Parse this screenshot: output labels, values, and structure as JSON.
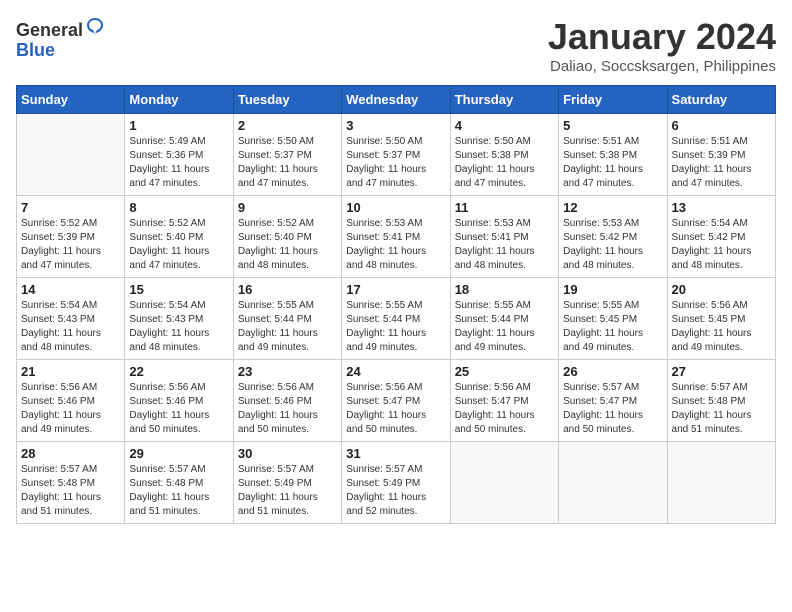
{
  "header": {
    "logo_line1": "General",
    "logo_line2": "Blue",
    "month_title": "January 2024",
    "subtitle": "Daliao, Soccsksargen, Philippines"
  },
  "days_of_week": [
    "Sunday",
    "Monday",
    "Tuesday",
    "Wednesday",
    "Thursday",
    "Friday",
    "Saturday"
  ],
  "weeks": [
    [
      {
        "num": "",
        "info": ""
      },
      {
        "num": "1",
        "info": "Sunrise: 5:49 AM\nSunset: 5:36 PM\nDaylight: 11 hours\nand 47 minutes."
      },
      {
        "num": "2",
        "info": "Sunrise: 5:50 AM\nSunset: 5:37 PM\nDaylight: 11 hours\nand 47 minutes."
      },
      {
        "num": "3",
        "info": "Sunrise: 5:50 AM\nSunset: 5:37 PM\nDaylight: 11 hours\nand 47 minutes."
      },
      {
        "num": "4",
        "info": "Sunrise: 5:50 AM\nSunset: 5:38 PM\nDaylight: 11 hours\nand 47 minutes."
      },
      {
        "num": "5",
        "info": "Sunrise: 5:51 AM\nSunset: 5:38 PM\nDaylight: 11 hours\nand 47 minutes."
      },
      {
        "num": "6",
        "info": "Sunrise: 5:51 AM\nSunset: 5:39 PM\nDaylight: 11 hours\nand 47 minutes."
      }
    ],
    [
      {
        "num": "7",
        "info": "Sunrise: 5:52 AM\nSunset: 5:39 PM\nDaylight: 11 hours\nand 47 minutes."
      },
      {
        "num": "8",
        "info": "Sunrise: 5:52 AM\nSunset: 5:40 PM\nDaylight: 11 hours\nand 47 minutes."
      },
      {
        "num": "9",
        "info": "Sunrise: 5:52 AM\nSunset: 5:40 PM\nDaylight: 11 hours\nand 48 minutes."
      },
      {
        "num": "10",
        "info": "Sunrise: 5:53 AM\nSunset: 5:41 PM\nDaylight: 11 hours\nand 48 minutes."
      },
      {
        "num": "11",
        "info": "Sunrise: 5:53 AM\nSunset: 5:41 PM\nDaylight: 11 hours\nand 48 minutes."
      },
      {
        "num": "12",
        "info": "Sunrise: 5:53 AM\nSunset: 5:42 PM\nDaylight: 11 hours\nand 48 minutes."
      },
      {
        "num": "13",
        "info": "Sunrise: 5:54 AM\nSunset: 5:42 PM\nDaylight: 11 hours\nand 48 minutes."
      }
    ],
    [
      {
        "num": "14",
        "info": "Sunrise: 5:54 AM\nSunset: 5:43 PM\nDaylight: 11 hours\nand 48 minutes."
      },
      {
        "num": "15",
        "info": "Sunrise: 5:54 AM\nSunset: 5:43 PM\nDaylight: 11 hours\nand 48 minutes."
      },
      {
        "num": "16",
        "info": "Sunrise: 5:55 AM\nSunset: 5:44 PM\nDaylight: 11 hours\nand 49 minutes."
      },
      {
        "num": "17",
        "info": "Sunrise: 5:55 AM\nSunset: 5:44 PM\nDaylight: 11 hours\nand 49 minutes."
      },
      {
        "num": "18",
        "info": "Sunrise: 5:55 AM\nSunset: 5:44 PM\nDaylight: 11 hours\nand 49 minutes."
      },
      {
        "num": "19",
        "info": "Sunrise: 5:55 AM\nSunset: 5:45 PM\nDaylight: 11 hours\nand 49 minutes."
      },
      {
        "num": "20",
        "info": "Sunrise: 5:56 AM\nSunset: 5:45 PM\nDaylight: 11 hours\nand 49 minutes."
      }
    ],
    [
      {
        "num": "21",
        "info": "Sunrise: 5:56 AM\nSunset: 5:46 PM\nDaylight: 11 hours\nand 49 minutes."
      },
      {
        "num": "22",
        "info": "Sunrise: 5:56 AM\nSunset: 5:46 PM\nDaylight: 11 hours\nand 50 minutes."
      },
      {
        "num": "23",
        "info": "Sunrise: 5:56 AM\nSunset: 5:46 PM\nDaylight: 11 hours\nand 50 minutes."
      },
      {
        "num": "24",
        "info": "Sunrise: 5:56 AM\nSunset: 5:47 PM\nDaylight: 11 hours\nand 50 minutes."
      },
      {
        "num": "25",
        "info": "Sunrise: 5:56 AM\nSunset: 5:47 PM\nDaylight: 11 hours\nand 50 minutes."
      },
      {
        "num": "26",
        "info": "Sunrise: 5:57 AM\nSunset: 5:47 PM\nDaylight: 11 hours\nand 50 minutes."
      },
      {
        "num": "27",
        "info": "Sunrise: 5:57 AM\nSunset: 5:48 PM\nDaylight: 11 hours\nand 51 minutes."
      }
    ],
    [
      {
        "num": "28",
        "info": "Sunrise: 5:57 AM\nSunset: 5:48 PM\nDaylight: 11 hours\nand 51 minutes."
      },
      {
        "num": "29",
        "info": "Sunrise: 5:57 AM\nSunset: 5:48 PM\nDaylight: 11 hours\nand 51 minutes."
      },
      {
        "num": "30",
        "info": "Sunrise: 5:57 AM\nSunset: 5:49 PM\nDaylight: 11 hours\nand 51 minutes."
      },
      {
        "num": "31",
        "info": "Sunrise: 5:57 AM\nSunset: 5:49 PM\nDaylight: 11 hours\nand 52 minutes."
      },
      {
        "num": "",
        "info": ""
      },
      {
        "num": "",
        "info": ""
      },
      {
        "num": "",
        "info": ""
      }
    ]
  ]
}
